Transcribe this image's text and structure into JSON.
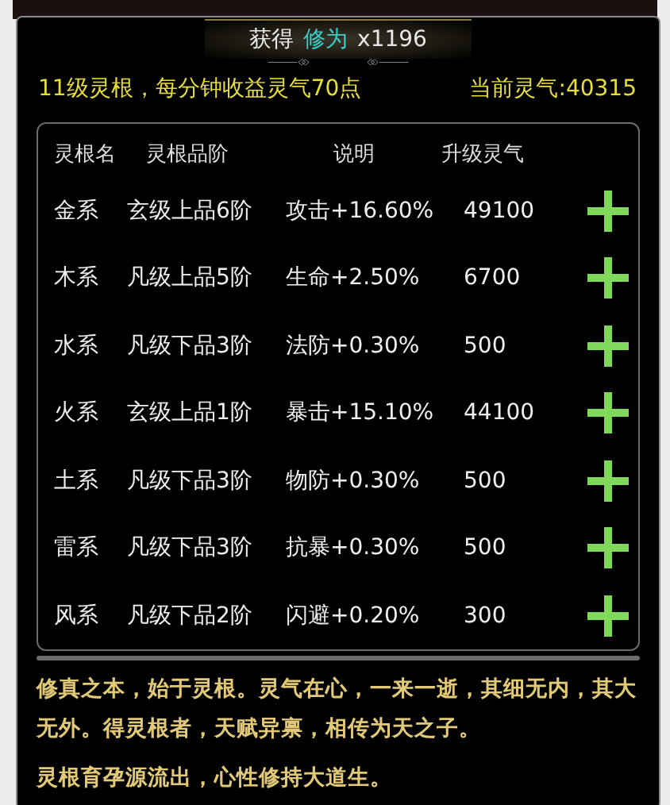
{
  "toast": {
    "label": "获得",
    "item": "修为",
    "count": "x1196"
  },
  "info": {
    "level_text": "11级灵根，每分钟收益灵气70点",
    "current": "当前灵气:40315"
  },
  "table": {
    "columns": [
      "灵根名",
      "灵根品阶",
      "说明",
      "升级灵气"
    ],
    "rows": [
      {
        "name": "金系",
        "grade": "玄级上品6阶",
        "effect": "攻击+16.60%",
        "cost": "49100"
      },
      {
        "name": "木系",
        "grade": "凡级上品5阶",
        "effect": "生命+2.50%",
        "cost": "6700"
      },
      {
        "name": "水系",
        "grade": "凡级下品3阶",
        "effect": "法防+0.30%",
        "cost": "500"
      },
      {
        "name": "火系",
        "grade": "玄级上品1阶",
        "effect": "暴击+15.10%",
        "cost": "44100"
      },
      {
        "name": "土系",
        "grade": "凡级下品3阶",
        "effect": "物防+0.30%",
        "cost": "500"
      },
      {
        "name": "雷系",
        "grade": "凡级下品3阶",
        "effect": "抗暴+0.30%",
        "cost": "500"
      },
      {
        "name": "风系",
        "grade": "凡级下品2阶",
        "effect": "闪避+0.20%",
        "cost": "300"
      }
    ]
  },
  "description": [
    "修真之本，始于灵根。灵气在心，一来一逝，其细无内，其大无外。得灵根者，天赋异禀，相传为天之子。",
    "灵根育孕源流出，心性修持大道生。"
  ]
}
